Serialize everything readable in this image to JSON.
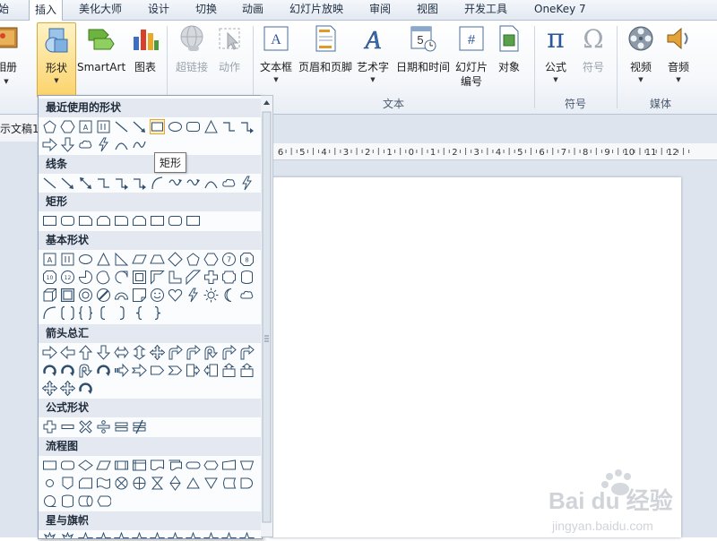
{
  "tabs": [
    "始",
    "插入",
    "美化大师",
    "设计",
    "切换",
    "动画",
    "幻灯片放映",
    "审阅",
    "视图",
    "开发工具",
    "OneKey 7"
  ],
  "active_tab": "插入",
  "ribbon": {
    "buttons": {
      "album": "相册",
      "shapes": "形状",
      "smartart": "SmartArt",
      "chart": "图表",
      "hyperlink": "超链接",
      "action": "动作",
      "textbox": "文本框",
      "header_footer": "页眉和页脚",
      "wordart": "艺术字",
      "datetime": "日期和时间",
      "slide_number_1": "幻灯片",
      "slide_number_2": "编号",
      "object": "对象",
      "equation": "公式",
      "symbol": "符号",
      "video": "视频",
      "audio": "音频"
    },
    "groups": {
      "text": "文本",
      "symbols": "符号",
      "media": "媒体"
    }
  },
  "document_tab": "示文稿1",
  "ruler_labels": [
    "6",
    "5",
    "4",
    "3",
    "2",
    "1",
    "0",
    "1",
    "2",
    "3",
    "4",
    "5",
    "6",
    "7",
    "8",
    "9",
    "10",
    "11",
    "12"
  ],
  "shapes_panel": {
    "categories": {
      "recent": "最近使用的形状",
      "lines": "线条",
      "rectangles": "矩形",
      "basic": "基本形状",
      "arrows": "箭头总汇",
      "equation": "公式形状",
      "flowchart": "流程图",
      "stars": "星与旗帜"
    },
    "tooltip": "矩形"
  },
  "watermark": {
    "brand": "Bai du 经验",
    "url": "jingyan.baidu.com"
  },
  "colors": {
    "accent": "#2b579a",
    "highlight": "#fbd36b",
    "shape_stroke": "#2f4f6f",
    "panel_header": "#e4e9f1"
  }
}
